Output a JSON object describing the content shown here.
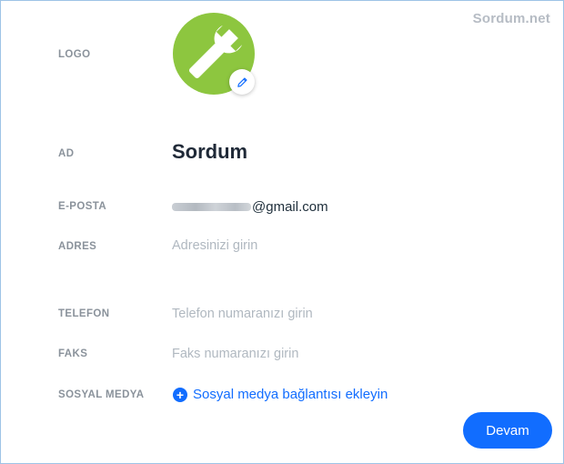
{
  "watermark": "Sordum.net",
  "labels": {
    "logo": "LOGO",
    "name": "AD",
    "email": "E-POSTA",
    "address": "ADRES",
    "phone": "TELEFON",
    "fax": "FAKS",
    "social": "SOSYAL MEDYA"
  },
  "profile": {
    "name": "Sordum",
    "email_domain": "@gmail.com"
  },
  "placeholders": {
    "address": "Adresinizi girin",
    "phone": "Telefon numaranızı girin",
    "fax": "Faks numaranızı girin"
  },
  "social": {
    "add_label": "Sosyal medya bağlantısı ekleyin"
  },
  "buttons": {
    "continue": "Devam"
  },
  "icons": {
    "logo": "wrench-icon",
    "edit": "pencil-icon",
    "add": "plus-icon"
  },
  "colors": {
    "accent": "#116dff",
    "logo_bg": "#8dc63f"
  }
}
